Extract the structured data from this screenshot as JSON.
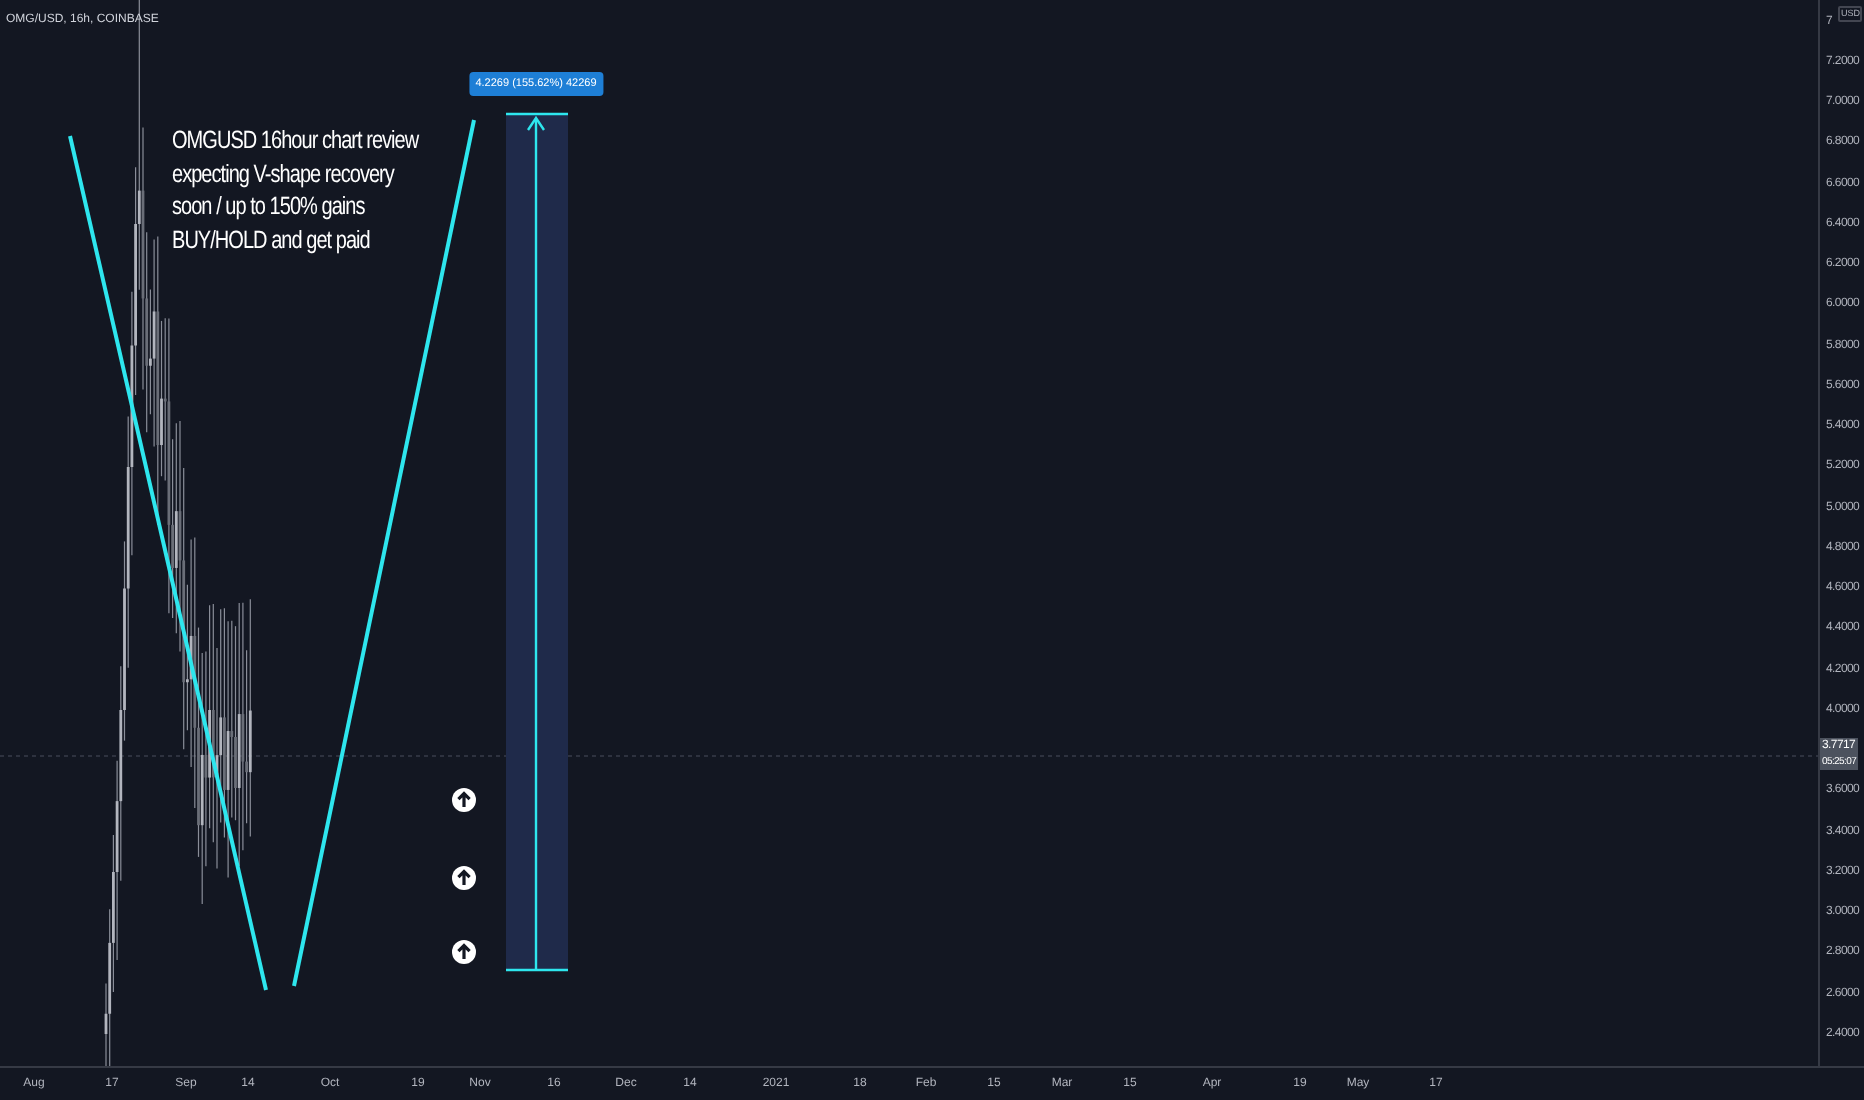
{
  "header": {
    "symbol": "OMG/USD, 16h, COINBASE"
  },
  "annotation": {
    "lines": [
      "OMGUSD 16hour chart review",
      "expecting V-shape recovery",
      "soon / up to 150% gains",
      "BUY/HOLD and get paid"
    ]
  },
  "measure": {
    "label": "4.2269 (155.62%) 42269"
  },
  "markers": [
    {
      "kind": "arrow-up"
    },
    {
      "kind": "arrow-up"
    },
    {
      "kind": "arrow-up"
    }
  ],
  "price_axis": {
    "currency": "USD",
    "labels": [
      "7",
      "7.2000",
      "7.0000",
      "6.8000",
      "6.6000",
      "6.4000",
      "6.2000",
      "6.0000",
      "5.8000",
      "5.6000",
      "5.4000",
      "5.2000",
      "5.0000",
      "4.8000",
      "4.6000",
      "4.4000",
      "4.2000",
      "4.0000",
      "3.6000",
      "3.4000",
      "3.2000",
      "3.0000",
      "2.8000",
      "2.6000",
      "2.4000"
    ],
    "last_price": "3.7717",
    "countdown": "05:25:07"
  },
  "time_axis": {
    "labels": [
      "Aug",
      "17",
      "Sep",
      "14",
      "Oct",
      "19",
      "Nov",
      "16",
      "Dec",
      "14",
      "2021",
      "18",
      "Feb",
      "15",
      "Mar",
      "15",
      "Apr",
      "19",
      "May",
      "17"
    ]
  }
}
